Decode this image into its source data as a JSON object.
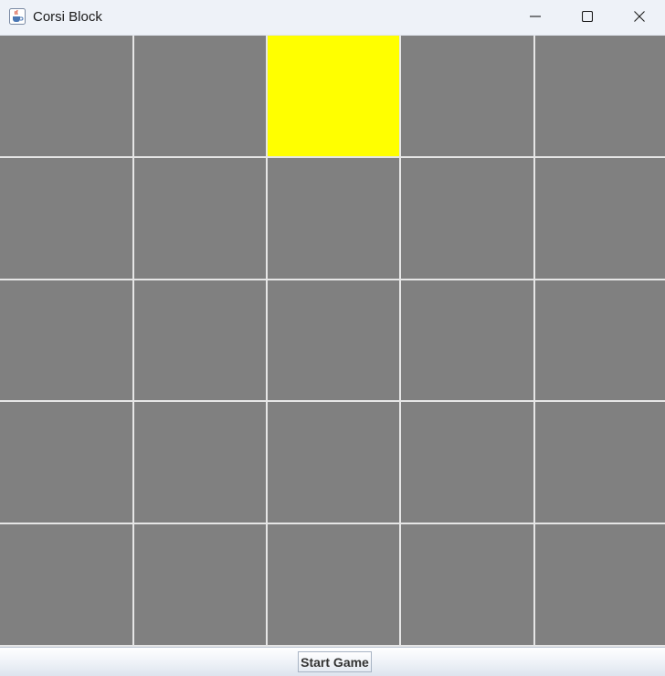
{
  "window": {
    "title": "Corsi Block",
    "app_icon": "java-coffee-cup-icon",
    "controls": [
      "minimize-icon",
      "maximize-icon",
      "close-icon"
    ]
  },
  "board": {
    "rows": 5,
    "cols": 5,
    "cell_color": "#808080",
    "highlight_color": "#ffff00",
    "gap_color": "#e6e6e6",
    "highlighted_cells": [
      {
        "row": 1,
        "col": 3
      }
    ]
  },
  "controls": {
    "start_label": "Start Game"
  }
}
